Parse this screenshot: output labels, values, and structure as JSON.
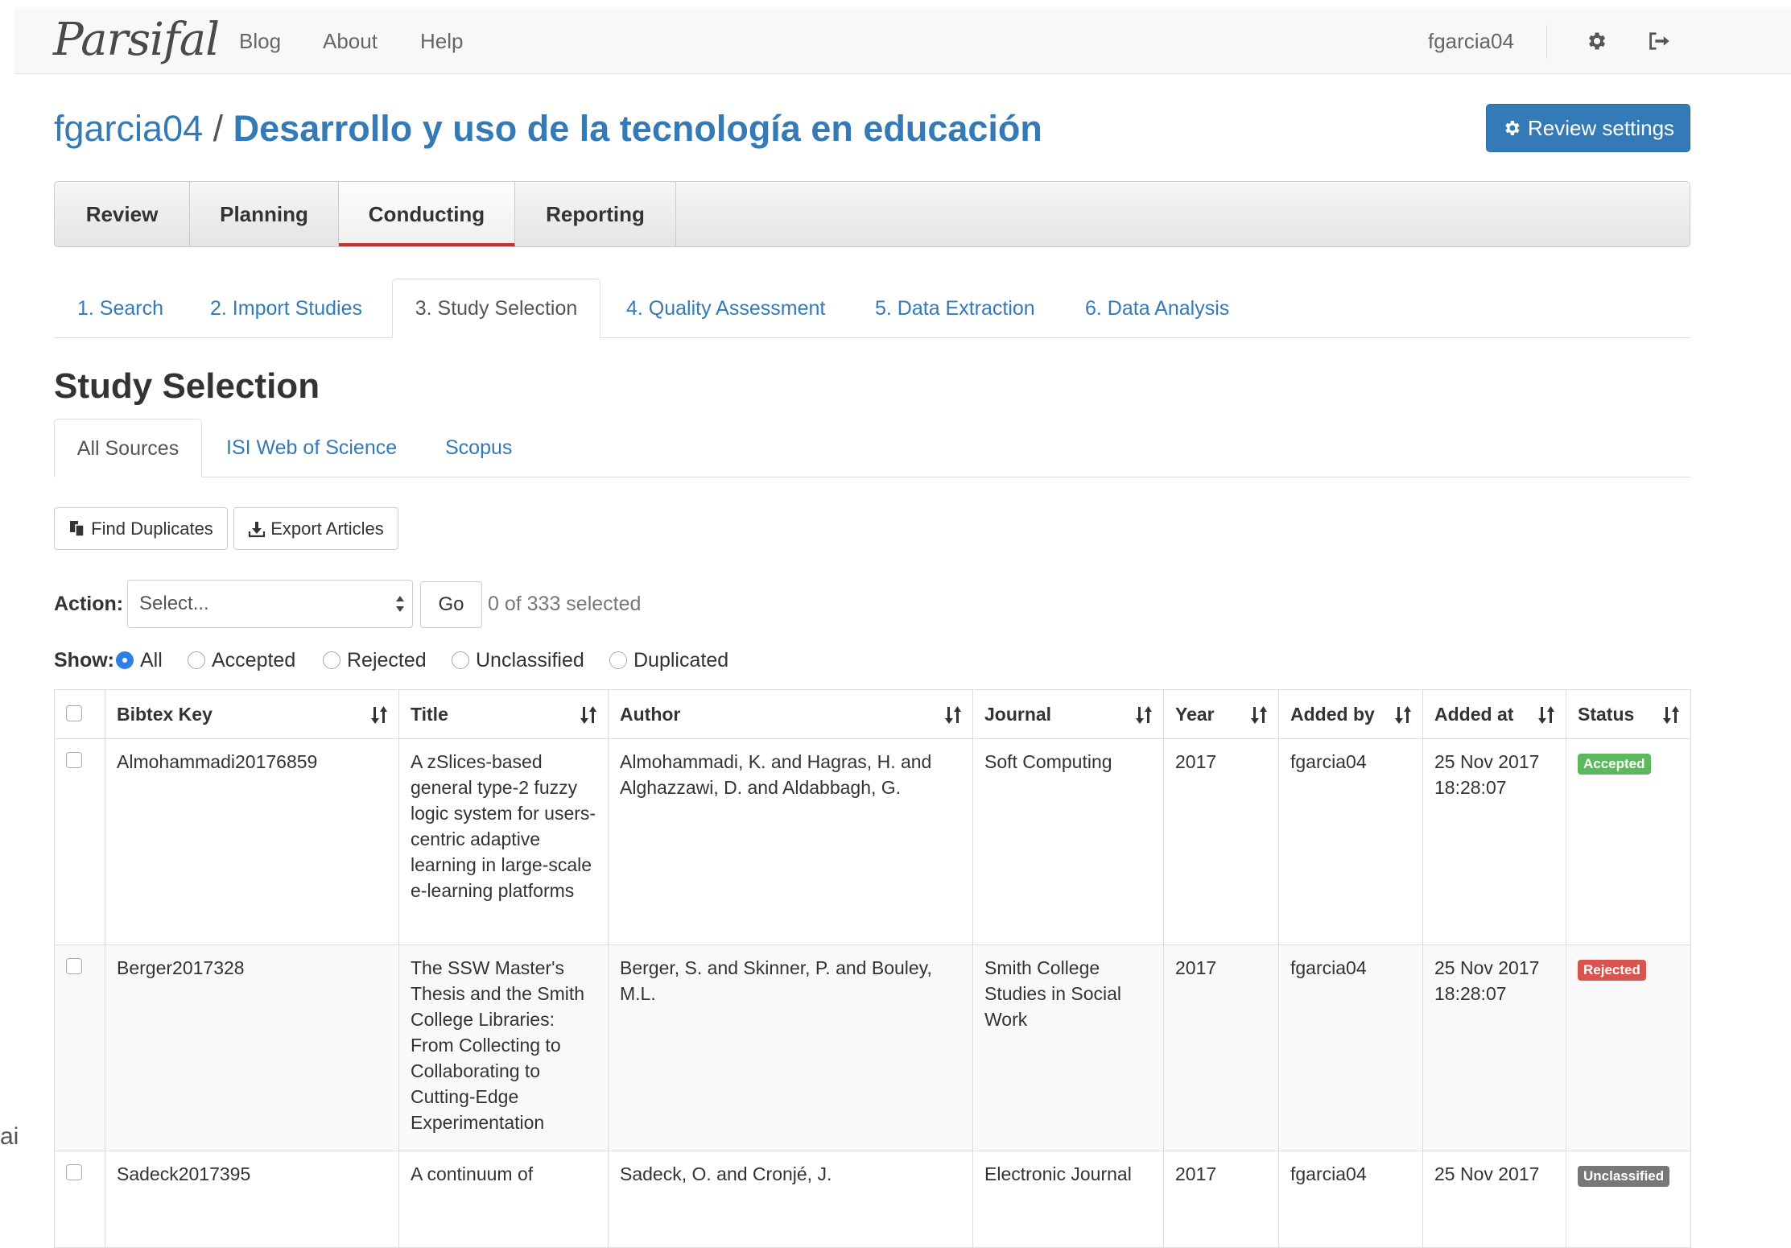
{
  "navbar": {
    "brand": "Parsifal",
    "links": [
      "Blog",
      "About",
      "Help"
    ],
    "username": "fgarcia04",
    "icons": [
      "gear-icon",
      "sign-out-icon"
    ]
  },
  "header": {
    "owner": "fgarcia04",
    "separator": " / ",
    "project": "Desarrollo y uso de la tecnología en educación",
    "settings_button": "Review settings"
  },
  "main_tabs": {
    "items": [
      "Review",
      "Planning",
      "Conducting",
      "Reporting"
    ],
    "active": "Conducting"
  },
  "sub_tabs": {
    "items": [
      "1. Search",
      "2. Import Studies",
      "3. Study Selection",
      "4. Quality Assessment",
      "5. Data Extraction",
      "6. Data Analysis"
    ],
    "active": "3. Study Selection"
  },
  "section": {
    "title": "Study Selection",
    "source_tabs": [
      "All Sources",
      "ISI Web of Science",
      "Scopus"
    ],
    "active_source": "All Sources"
  },
  "toolbar": {
    "find_duplicates": "Find Duplicates",
    "export_articles": "Export Articles",
    "action_label": "Action:",
    "action_placeholder": "Select...",
    "go": "Go",
    "selected_count": "0 of 333 selected",
    "show_label": "Show:",
    "filters": [
      "All",
      "Accepted",
      "Rejected",
      "Unclassified",
      "Duplicated"
    ],
    "active_filter": "All"
  },
  "table": {
    "columns": [
      "Bibtex Key",
      "Title",
      "Author",
      "Journal",
      "Year",
      "Added by",
      "Added at",
      "Status"
    ],
    "rows": [
      {
        "key": "Almohammadi20176859",
        "title": "A zSlices-based general type-2 fuzzy logic system for users-centric adaptive learning in large-scale e-learning platforms",
        "author": "Almohammadi, K. and Hagras, H. and Alghazzawi, D. and Aldabbagh, G.",
        "journal": "Soft Computing",
        "year": "2017",
        "added_by": "fgarcia04",
        "added_at": "25 Nov 2017 18:28:07",
        "status": "Accepted",
        "status_color": "#5cb85c"
      },
      {
        "key": "Berger2017328",
        "title": "The SSW Master's Thesis and the Smith College Libraries: From Collecting to Collaborating to Cutting-Edge Experimentation",
        "author": "Berger, S. and Skinner, P. and Bouley, M.L.",
        "journal": "Smith College Studies in Social Work",
        "year": "2017",
        "added_by": "fgarcia04",
        "added_at": "25 Nov 2017 18:28:07",
        "status": "Rejected",
        "status_color": "#d9534f"
      },
      {
        "key": "Sadeck2017395",
        "title": "A continuum of",
        "author": "Sadeck, O. and Cronjé, J.",
        "journal": "Electronic Journal",
        "year": "2017",
        "added_by": "fgarcia04",
        "added_at": "25 Nov 2017",
        "status": "Unclassified",
        "status_color": "#777777"
      }
    ]
  },
  "edge_fragment": "ai"
}
